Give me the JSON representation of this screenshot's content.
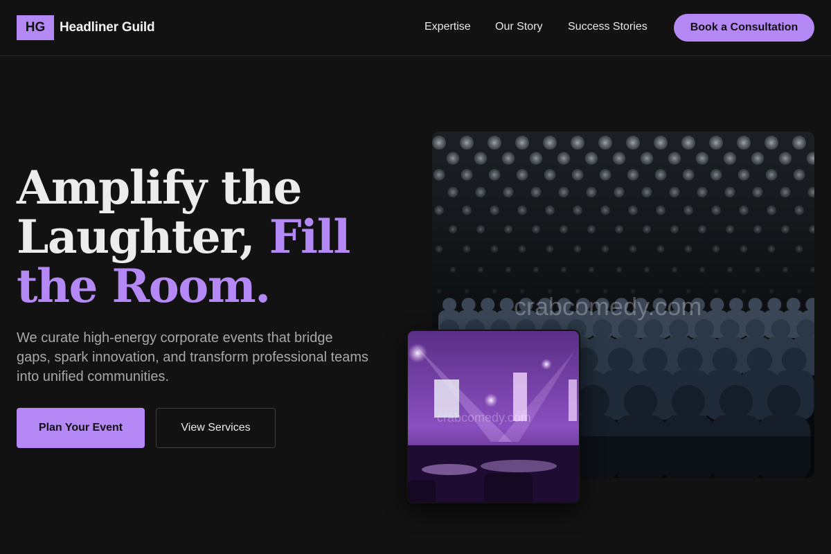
{
  "header": {
    "logo_text": "HG",
    "brand_name": "Headliner Guild",
    "nav": [
      "Expertise",
      "Our Story",
      "Success Stories"
    ],
    "cta_label": "Book a Consultation"
  },
  "hero": {
    "headline_part1": "Amplify the Laughter,",
    "headline_part2": "Fill the Room.",
    "subtext": "We curate high-energy corporate events that bridge gaps, spark innovation, and transform professional teams into unified communities.",
    "primary_button": "Plan Your Event",
    "secondary_button": "View Services"
  },
  "images": {
    "main_watermark": "crabcomedy.com",
    "inset_watermark": "crabcomedy.com"
  },
  "colors": {
    "accent": "#b589f5",
    "background": "#121212"
  }
}
